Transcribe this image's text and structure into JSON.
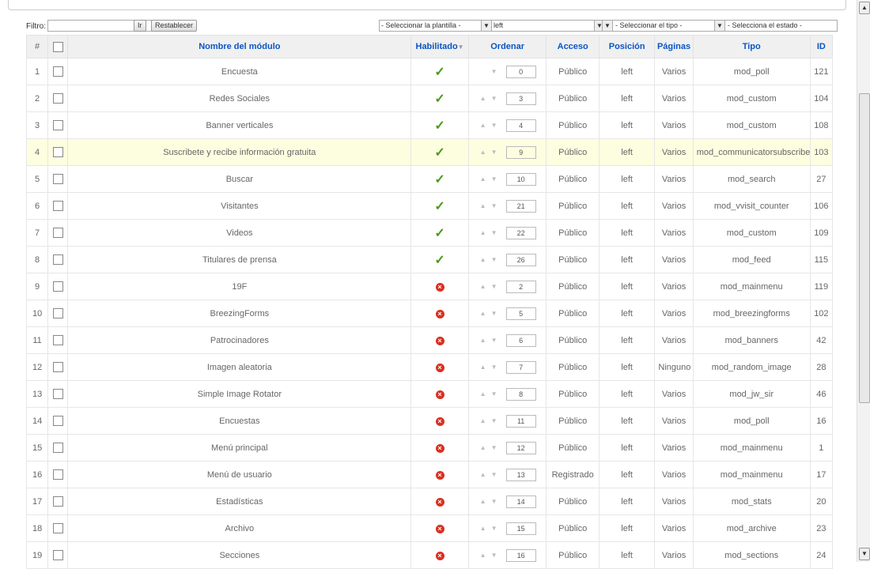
{
  "filter": {
    "label": "Filtro:",
    "value": "",
    "go_label": "Ir",
    "reset_label": "Restablecer",
    "template_select": "- Seleccionar la plantilla -",
    "position_select": "left",
    "type_select": "- Seleccionar el tipo -",
    "state_select": "- Selecciona el estado -"
  },
  "headers": {
    "num": "#",
    "name": "Nombre del módulo",
    "enabled": "Habilitado",
    "order": "Ordenar",
    "access": "Acceso",
    "position": "Posición",
    "pages": "Páginas",
    "type": "Tipo",
    "id": "ID"
  },
  "rows": [
    {
      "num": "1",
      "name": "Encuesta",
      "enabled": true,
      "order": "0",
      "up": false,
      "down": true,
      "access": "Público",
      "position": "left",
      "pages": "Varios",
      "type": "mod_poll",
      "id": "121"
    },
    {
      "num": "2",
      "name": "Redes Sociales",
      "enabled": true,
      "order": "3",
      "up": true,
      "down": true,
      "access": "Público",
      "position": "left",
      "pages": "Varios",
      "type": "mod_custom",
      "id": "104"
    },
    {
      "num": "3",
      "name": "Banner verticales",
      "enabled": true,
      "order": "4",
      "up": true,
      "down": true,
      "access": "Público",
      "position": "left",
      "pages": "Varios",
      "type": "mod_custom",
      "id": "108"
    },
    {
      "num": "4",
      "name": "Suscribete y recibe información gratuita",
      "enabled": true,
      "order": "9",
      "up": true,
      "down": true,
      "access": "Público",
      "position": "left",
      "pages": "Varios",
      "type": "mod_communicatorsubscribe",
      "id": "103"
    },
    {
      "num": "5",
      "name": "Buscar",
      "enabled": true,
      "order": "10",
      "up": true,
      "down": true,
      "access": "Público",
      "position": "left",
      "pages": "Varios",
      "type": "mod_search",
      "id": "27"
    },
    {
      "num": "6",
      "name": "Visitantes",
      "enabled": true,
      "order": "21",
      "up": true,
      "down": true,
      "access": "Público",
      "position": "left",
      "pages": "Varios",
      "type": "mod_vvisit_counter",
      "id": "106"
    },
    {
      "num": "7",
      "name": "Videos",
      "enabled": true,
      "order": "22",
      "up": true,
      "down": true,
      "access": "Público",
      "position": "left",
      "pages": "Varios",
      "type": "mod_custom",
      "id": "109"
    },
    {
      "num": "8",
      "name": "Titulares de prensa",
      "enabled": true,
      "order": "26",
      "up": true,
      "down": true,
      "access": "Público",
      "position": "left",
      "pages": "Varios",
      "type": "mod_feed",
      "id": "115"
    },
    {
      "num": "9",
      "name": "19F",
      "enabled": false,
      "order": "2",
      "up": true,
      "down": true,
      "access": "Público",
      "position": "left",
      "pages": "Varios",
      "type": "mod_mainmenu",
      "id": "119"
    },
    {
      "num": "10",
      "name": "BreezingForms",
      "enabled": false,
      "order": "5",
      "up": true,
      "down": true,
      "access": "Público",
      "position": "left",
      "pages": "Varios",
      "type": "mod_breezingforms",
      "id": "102"
    },
    {
      "num": "11",
      "name": "Patrocinadores",
      "enabled": false,
      "order": "6",
      "up": true,
      "down": true,
      "access": "Público",
      "position": "left",
      "pages": "Varios",
      "type": "mod_banners",
      "id": "42"
    },
    {
      "num": "12",
      "name": "Imagen aleatoria",
      "enabled": false,
      "order": "7",
      "up": true,
      "down": true,
      "access": "Público",
      "position": "left",
      "pages": "Ninguno",
      "type": "mod_random_image",
      "id": "28"
    },
    {
      "num": "13",
      "name": "Simple Image Rotator",
      "enabled": false,
      "order": "8",
      "up": true,
      "down": true,
      "access": "Público",
      "position": "left",
      "pages": "Varios",
      "type": "mod_jw_sir",
      "id": "46"
    },
    {
      "num": "14",
      "name": "Encuestas",
      "enabled": false,
      "order": "11",
      "up": true,
      "down": true,
      "access": "Público",
      "position": "left",
      "pages": "Varios",
      "type": "mod_poll",
      "id": "16"
    },
    {
      "num": "15",
      "name": "Menú principal",
      "enabled": false,
      "order": "12",
      "up": true,
      "down": true,
      "access": "Público",
      "position": "left",
      "pages": "Varios",
      "type": "mod_mainmenu",
      "id": "1"
    },
    {
      "num": "16",
      "name": "Menú de usuario",
      "enabled": false,
      "order": "13",
      "up": true,
      "down": true,
      "access": "Registrado",
      "position": "left",
      "pages": "Varios",
      "type": "mod_mainmenu",
      "id": "17"
    },
    {
      "num": "17",
      "name": "Estadísticas",
      "enabled": false,
      "order": "14",
      "up": true,
      "down": true,
      "access": "Público",
      "position": "left",
      "pages": "Varios",
      "type": "mod_stats",
      "id": "20"
    },
    {
      "num": "18",
      "name": "Archivo",
      "enabled": false,
      "order": "15",
      "up": true,
      "down": true,
      "access": "Público",
      "position": "left",
      "pages": "Varios",
      "type": "mod_archive",
      "id": "23"
    },
    {
      "num": "19",
      "name": "Secciones",
      "enabled": false,
      "order": "16",
      "up": true,
      "down": true,
      "access": "Público",
      "position": "left",
      "pages": "Varios",
      "type": "mod_sections",
      "id": "24"
    }
  ],
  "icons": {
    "enabled": "check-icon",
    "disabled": "disabled-x-icon",
    "up": "arrow-up-icon",
    "down": "arrow-down-icon",
    "sort": "sort-desc-icon"
  }
}
